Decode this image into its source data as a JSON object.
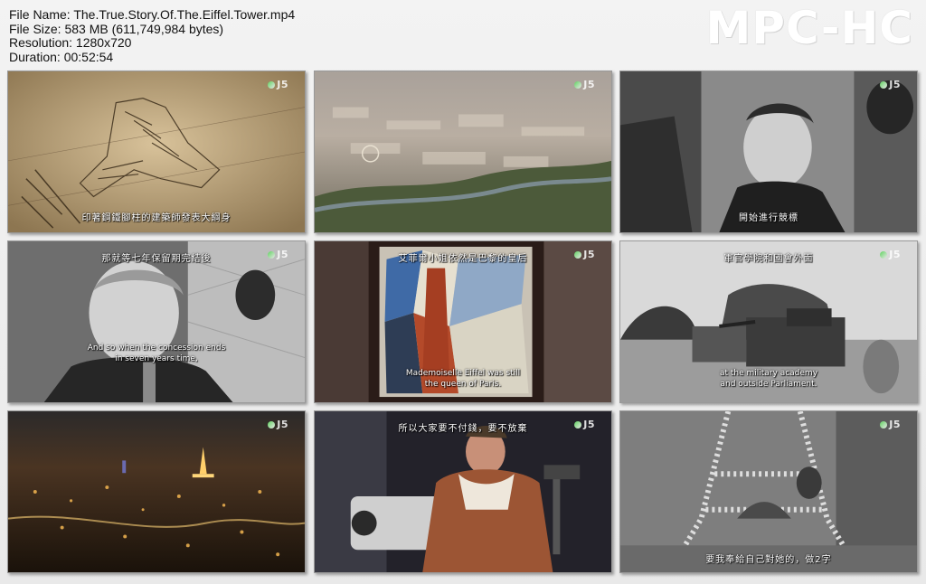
{
  "file_info": {
    "name": "File Name: The.True.Story.Of.The.Eiffel.Tower.mp4",
    "size": "File Size: 583 MB (611,749,984 bytes)",
    "resolution": "Resolution: 1280x720",
    "duration": "Duration: 00:52:54"
  },
  "logo_text": "MPC-HC",
  "channel_label": "J5",
  "thumbnails": [
    {
      "subtitle": "印著鋼鐵腳柱的建築師發表大綱身",
      "icon": "tower-sketch"
    },
    {
      "subtitle": "",
      "icon": "paris-aerial"
    },
    {
      "subtitle": "開始進行競標",
      "icon": "bw-man-speaking"
    },
    {
      "subtitle": "那就等七年保留期完結後",
      "subtitle_en_1": "And so when the concession ends",
      "subtitle_en_2": "in seven years time,",
      "icon": "bw-man-closeup"
    },
    {
      "subtitle": "艾菲爾小姐依然是巴黎的皇后",
      "subtitle_en_1": "Mademoiselle Eiffel was still",
      "subtitle_en_2": "the queen of Paris.",
      "icon": "cubist-painting"
    },
    {
      "subtitle": "軍官學院和國會外面",
      "subtitle_en_1": "at the military academy",
      "subtitle_en_2": "and outside Parliament.",
      "icon": "bw-tanks"
    },
    {
      "subtitle": "",
      "icon": "paris-night"
    },
    {
      "subtitle": "所以大家要不付錢，要不放棄",
      "icon": "presenter-panavision"
    },
    {
      "subtitle": "要我奉給自己對她的，做2字",
      "icon": "bw-tower-model"
    }
  ],
  "colors": {
    "background": "#ececec",
    "logo": "#ffffff"
  }
}
